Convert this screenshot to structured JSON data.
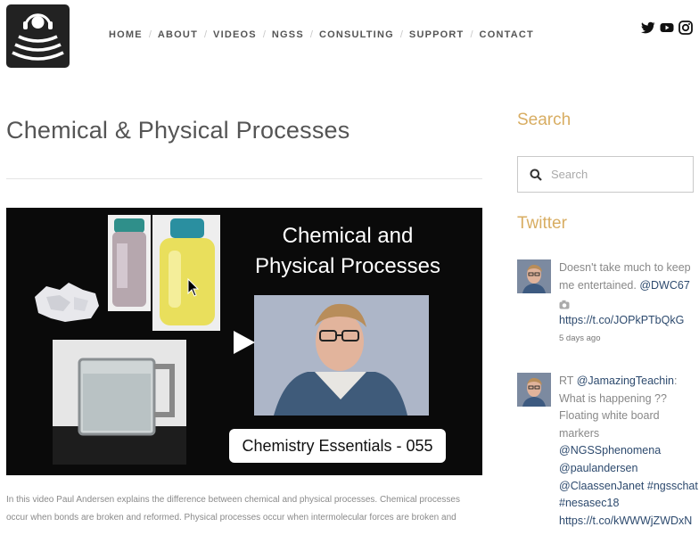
{
  "nav": {
    "items": [
      "HOME",
      "ABOUT",
      "VIDEOS",
      "NGSS",
      "CONSULTING",
      "SUPPORT",
      "CONTACT"
    ]
  },
  "social": {
    "icons": [
      "twitter-icon",
      "youtube-icon",
      "instagram-icon"
    ]
  },
  "page": {
    "title": "Chemical & Physical Processes"
  },
  "video": {
    "title_line1": "Chemical and",
    "title_line2": "Physical Processes",
    "caption": "Chemistry Essentials - 055"
  },
  "description": {
    "line1": "In this video Paul Andersen explains the difference between chemical and physical processes. Chemical processes",
    "line2": "occur when bonds are broken and reformed. Physical processes occur when intermolecular forces are broken and"
  },
  "sidebar": {
    "search_heading": "Search",
    "search_placeholder": "Search",
    "twitter_heading": "Twitter",
    "tweets": [
      {
        "line1": "Doesn't take much to keep",
        "line2_text": "me entertained. ",
        "mention": "@DWC67",
        "link": "https://t.co/JOPkPTbQkG",
        "time": "5 days ago"
      },
      {
        "rt": "RT ",
        "mention": "@JamazingTeachin",
        "colon": ":",
        "line2": "What is happening ??",
        "line3": "Floating white board",
        "line4": "markers",
        "tag1": "@NGSSphenomena",
        "tag2": "@paulandersen",
        "tag3": "@ClaassenJanet",
        "tag4": "#ngsschat",
        "tag5": "#nesasec18",
        "link": "https://t.co/kWWWjZWDxN"
      }
    ]
  },
  "colors": {
    "accent": "#d8ad62",
    "link": "#2d4a6e",
    "logo_bg": "#222222"
  }
}
